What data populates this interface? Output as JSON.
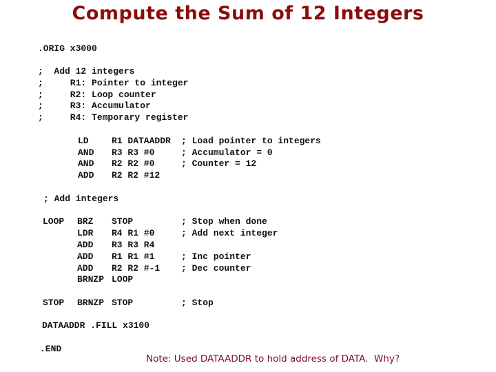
{
  "title": "Compute the Sum of 12 Integers",
  "orig": ".ORIG x3000",
  "header_comments": [
    ";  Add 12 integers",
    ";     R1: Pointer to integer",
    ";     R2: Loop counter",
    ";     R3: Accumulator",
    ";     R4: Temporary register"
  ],
  "init_block": [
    {
      "op": "LD",
      "args": "R1 DATAADDR",
      "comment": "; Load pointer to integers"
    },
    {
      "op": "AND",
      "args": "R3 R3 #0",
      "comment": "; Accumulator = 0"
    },
    {
      "op": "AND",
      "args": "R2 R2 #0",
      "comment": "; Counter = 12"
    },
    {
      "op": "ADD",
      "args": "R2 R2 #12",
      "comment": ""
    }
  ],
  "add_comment": "; Add integers",
  "loop_block": [
    {
      "label": "LOOP",
      "op": "BRZ",
      "args": "STOP",
      "comment": "; Stop when done"
    },
    {
      "label": "",
      "op": "LDR",
      "args": "R4 R1 #0",
      "comment": "; Add next integer"
    },
    {
      "label": "",
      "op": "ADD",
      "args": "R3 R3 R4",
      "comment": ""
    },
    {
      "label": "",
      "op": "ADD",
      "args": "R1 R1 #1",
      "comment": "; Inc pointer"
    },
    {
      "label": "",
      "op": "ADD",
      "args": "R2 R2 #-1",
      "comment": "; Dec counter"
    },
    {
      "label": "",
      "op": "BRNZP",
      "args": "LOOP",
      "comment": ""
    }
  ],
  "stop_line": {
    "label": "STOP",
    "op": "BRNZP",
    "args": "STOP",
    "comment": "; Stop"
  },
  "fill_line": "DATAADDR .FILL x3100",
  "end_line": ".END",
  "note": "Note: Used DATAADDR to hold address of DATA.  Why?"
}
